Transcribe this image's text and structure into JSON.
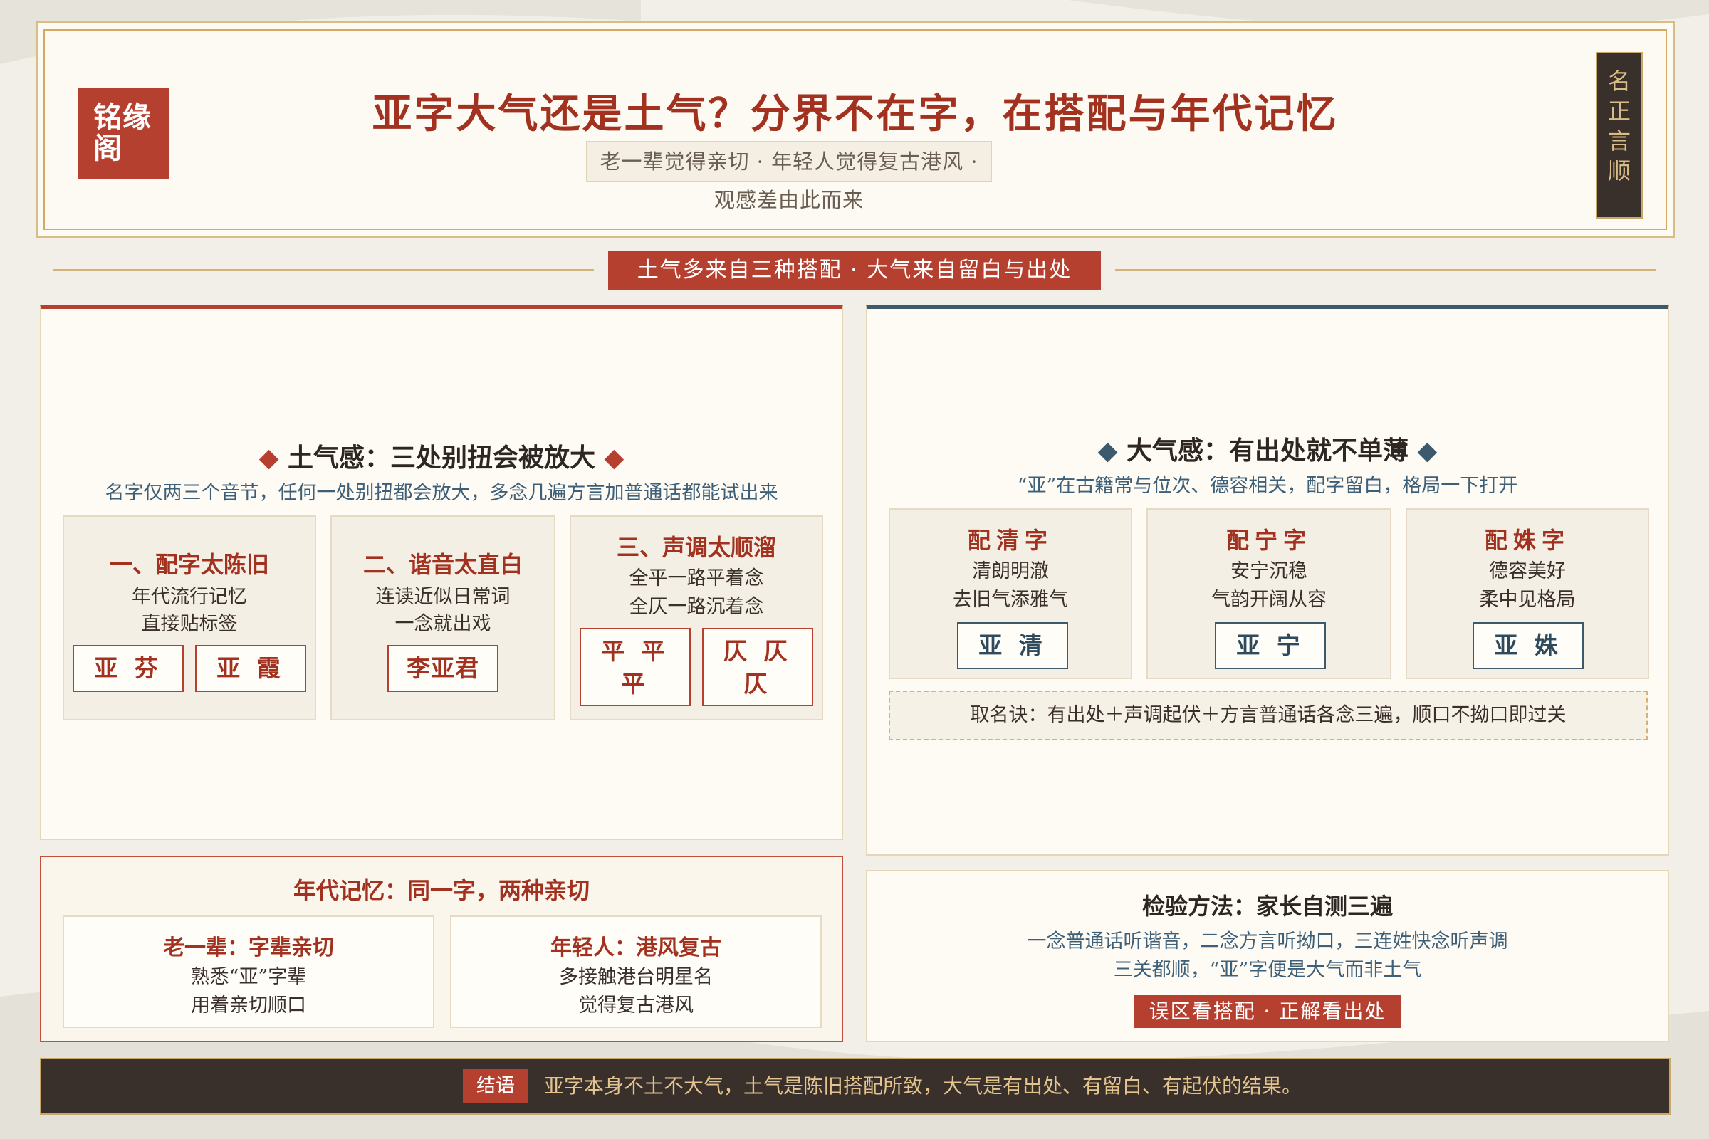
{
  "header": {
    "logo": [
      "铭缘",
      "阁"
    ],
    "title": "亚字大气还是土气？分界不在字，在搭配与年代记忆",
    "subtitle": "老一辈觉得亲切 · 年轻人觉得复古港风 · 观感差由此而来",
    "seal": [
      "名",
      "正",
      "言",
      "顺"
    ]
  },
  "banner": "土气多来自三种搭配 · 大气来自留白与出处",
  "left": {
    "title": "土气感：三处别扭会被放大",
    "desc": "名字仅两三个音节，任何一处别扭都会放大，多念几遍方言加普通话都能试出来",
    "cards": [
      {
        "title": "一、配字太陈旧",
        "lines": [
          "年代流行记忆",
          "直接贴标签"
        ],
        "tags": [
          "亚 芬",
          "亚 霞"
        ]
      },
      {
        "title": "二、谐音太直白",
        "lines": [
          "连读近似日常词",
          "一念就出戏"
        ],
        "tags": [
          "李亚君"
        ]
      },
      {
        "title": "三、声调太顺溜",
        "lines": [
          "全平一路平着念",
          "全仄一路沉着念"
        ],
        "tags": [
          [
            "平 平",
            "平"
          ],
          [
            "仄 仄",
            "仄"
          ]
        ]
      }
    ]
  },
  "right": {
    "title": "大气感：有出处就不单薄",
    "desc": "“亚”在古籍常与位次、德容相关，配字留白，格局一下打开",
    "cards": [
      {
        "title": "配清字",
        "lines": [
          "清朗明澈",
          "去旧气添雅气"
        ],
        "tag": "亚 清"
      },
      {
        "title": "配宁字",
        "lines": [
          "安宁沉稳",
          "气韵开阔从容"
        ],
        "tag": "亚 宁"
      },
      {
        "title": "配姝字",
        "lines": [
          "德容美好",
          "柔中见格局"
        ],
        "tag": "亚 姝"
      }
    ],
    "tip": "取名诀：有出处＋声调起伏＋方言普通话各念三遍，顺口不拗口即过关"
  },
  "memory": {
    "title": "年代记忆：同一字，两种亲切",
    "cards": [
      {
        "title": "老一辈：字辈亲切",
        "lines": [
          "熟悉“亚”字辈",
          "用着亲切顺口"
        ]
      },
      {
        "title": "年轻人：港风复古",
        "lines": [
          "多接触港台明星名",
          "觉得复古港风"
        ]
      }
    ]
  },
  "check": {
    "title": "检验方法：家长自测三遍",
    "lines": [
      "一念普通话听谐音，二念方言听拗口，三连姓快念听声调",
      "三关都顺，“亚”字便是大气而非土气"
    ],
    "button": "误区看搭配 · 正解看出处"
  },
  "footer": {
    "tag": "结语",
    "text": "亚字本身不土不大气，土气是陈旧搭配所致，大气是有出处、有留白、有起伏的结果。"
  },
  "colors": {
    "accent_red": "#b64030",
    "accent_blue": "#3c5a6c",
    "gold": "#d6a862",
    "dark": "#3a302b",
    "paper": "#fdfbf3"
  }
}
